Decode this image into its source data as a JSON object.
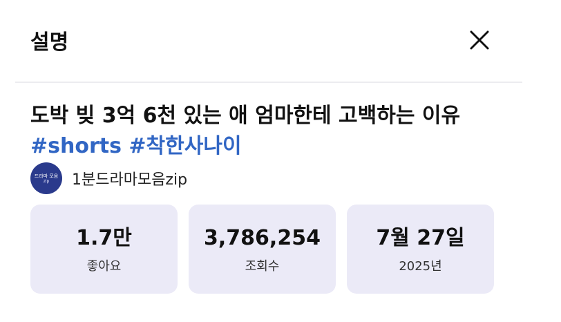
{
  "header": {
    "title": "설명",
    "close_icon": "close-icon"
  },
  "video": {
    "title": "도박 빚 3억 6천 있는 애 엄마한테 고백하는 이유",
    "hashtags": [
      "#shorts",
      "#착한사나이"
    ]
  },
  "channel": {
    "avatar_text_line1": "드라마 모음",
    "avatar_text_line2": "zip",
    "name": "1분드라마모음zip"
  },
  "stats": [
    {
      "value": "1.7만",
      "label": "좋아요"
    },
    {
      "value": "3,786,254",
      "label": "조회수"
    },
    {
      "value": "7월 27일",
      "label": "2025년"
    }
  ],
  "colors": {
    "hashtag": "#3166c4",
    "card_background": "#ebeaf7",
    "avatar_background": "#2a3a8c"
  }
}
